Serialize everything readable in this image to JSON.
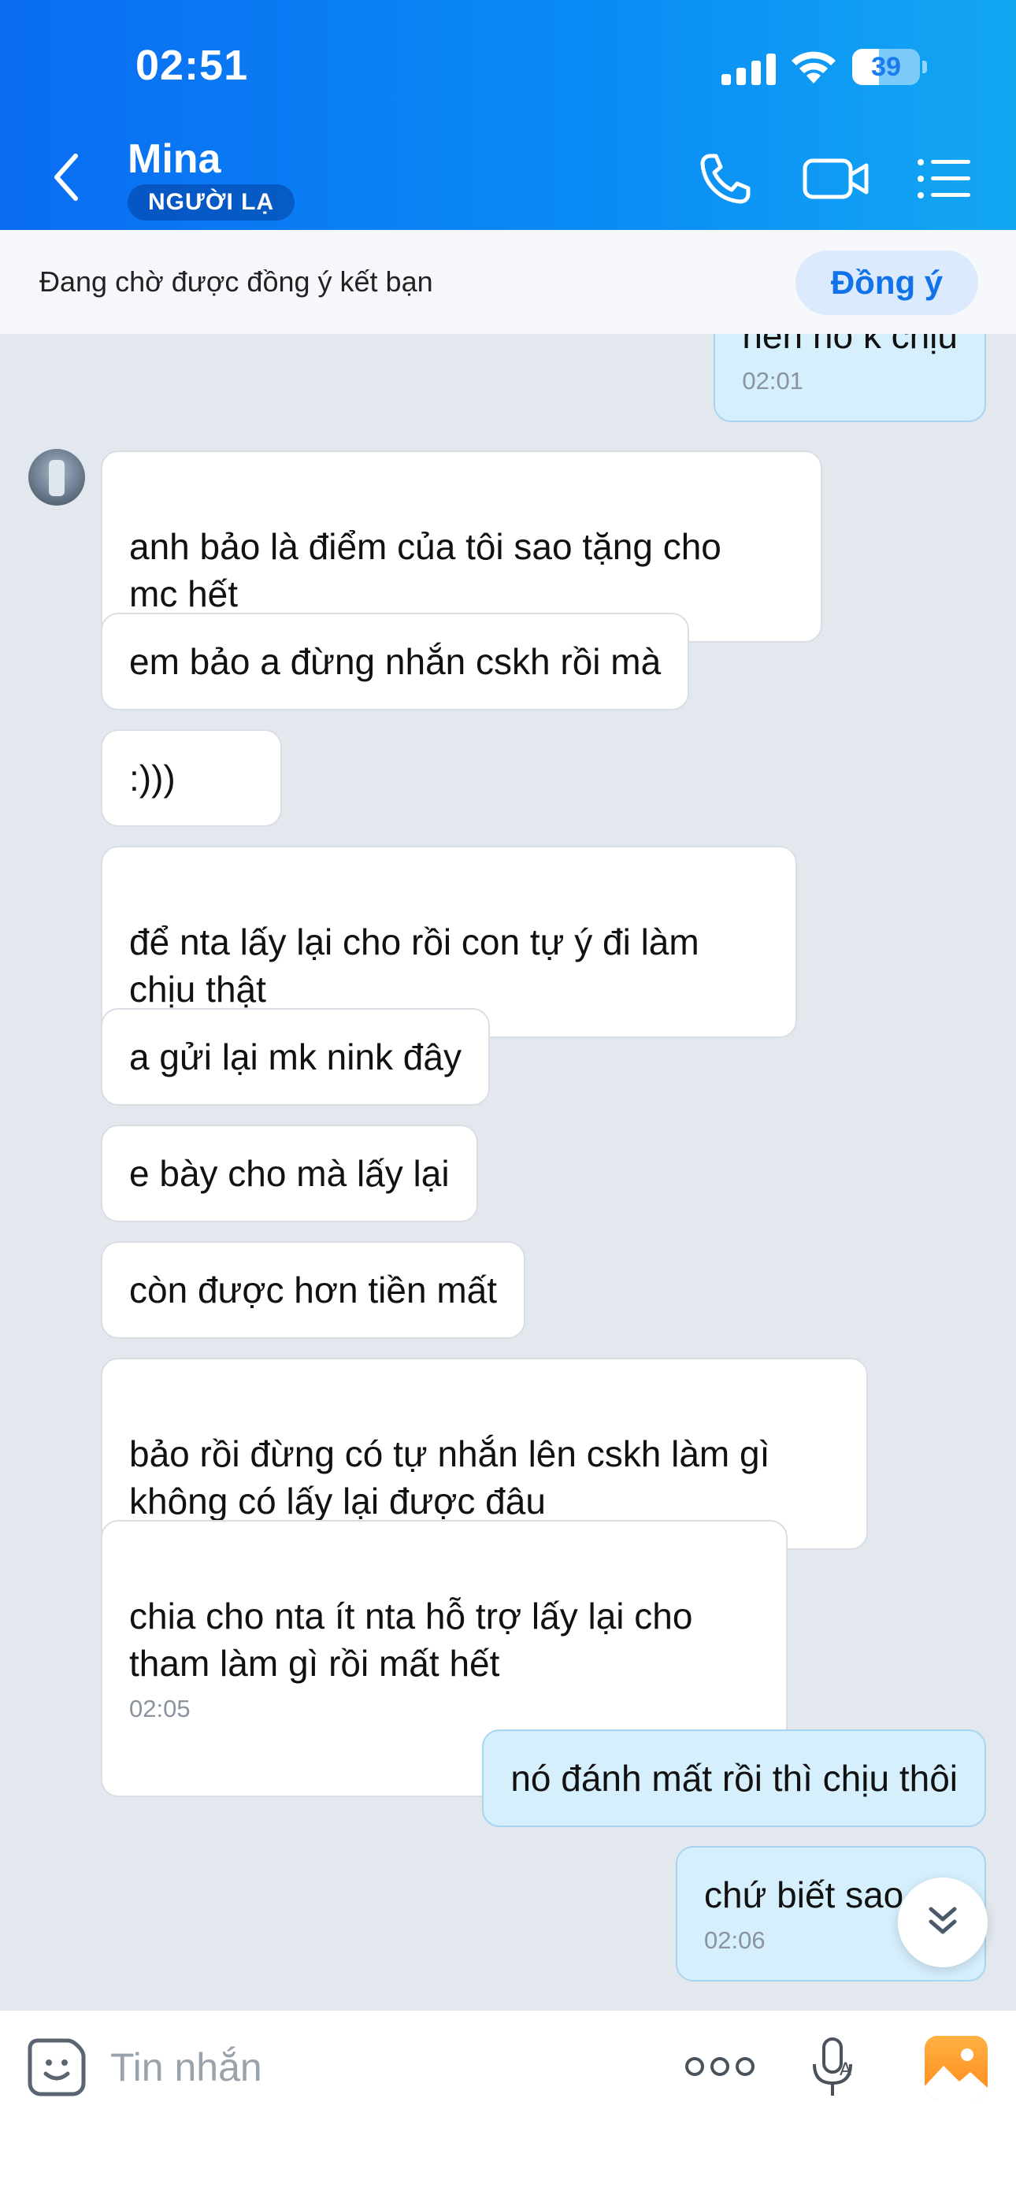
{
  "status_bar": {
    "time": "02:51",
    "battery": "39",
    "battery_level": 0.39
  },
  "header": {
    "contact_name": "Mina",
    "badge": "NGƯỜI LẠ",
    "icons": [
      "back-icon",
      "phone-icon",
      "video-camera-icon",
      "list-menu-icon"
    ]
  },
  "friend_request": {
    "text": "Đang chờ được đồng ý kết bạn",
    "accept_label": "Đồng ý"
  },
  "messages": [
    {
      "side": "out",
      "text": "nên nó k chịu",
      "time": "02:01"
    },
    {
      "side": "in",
      "text": "anh bảo là điểm của tôi sao tặng cho\nmc hết"
    },
    {
      "side": "in",
      "text": "em bảo a đừng nhắn cskh rồi mà"
    },
    {
      "side": "in",
      "text": ":)))"
    },
    {
      "side": "in",
      "text": "để nta lấy lại cho rồi con tự ý đi làm\nchịu thật"
    },
    {
      "side": "in",
      "text": "a gửi lại mk nink đây"
    },
    {
      "side": "in",
      "text": "e bày cho mà lấy lại"
    },
    {
      "side": "in",
      "text": "còn được hơn tiền mất"
    },
    {
      "side": "in",
      "text": "bảo rồi đừng có tự nhắn lên cskh làm gì\nkhông có lấy lại được đâu"
    },
    {
      "side": "in",
      "text": "chia cho nta ít nta hỗ trợ lấy lại cho\ntham làm gì rồi mất hết",
      "time": "02:05"
    },
    {
      "side": "out",
      "text": "nó đánh mất rồi thì chịu thôi"
    },
    {
      "side": "out",
      "text": "chứ biết sao",
      "time": "02:06"
    }
  ],
  "composer": {
    "placeholder": "Tin nhắn",
    "icons": [
      "sticker-icon",
      "more-icon",
      "voice-icon",
      "photo-icon"
    ]
  },
  "colors": {
    "header_start": "#0a6cf2",
    "header_end": "#13a7f2",
    "accent": "#1273e8",
    "outgoing_bubble": "#d6effd",
    "chat_bg": "#e3e8ef"
  }
}
